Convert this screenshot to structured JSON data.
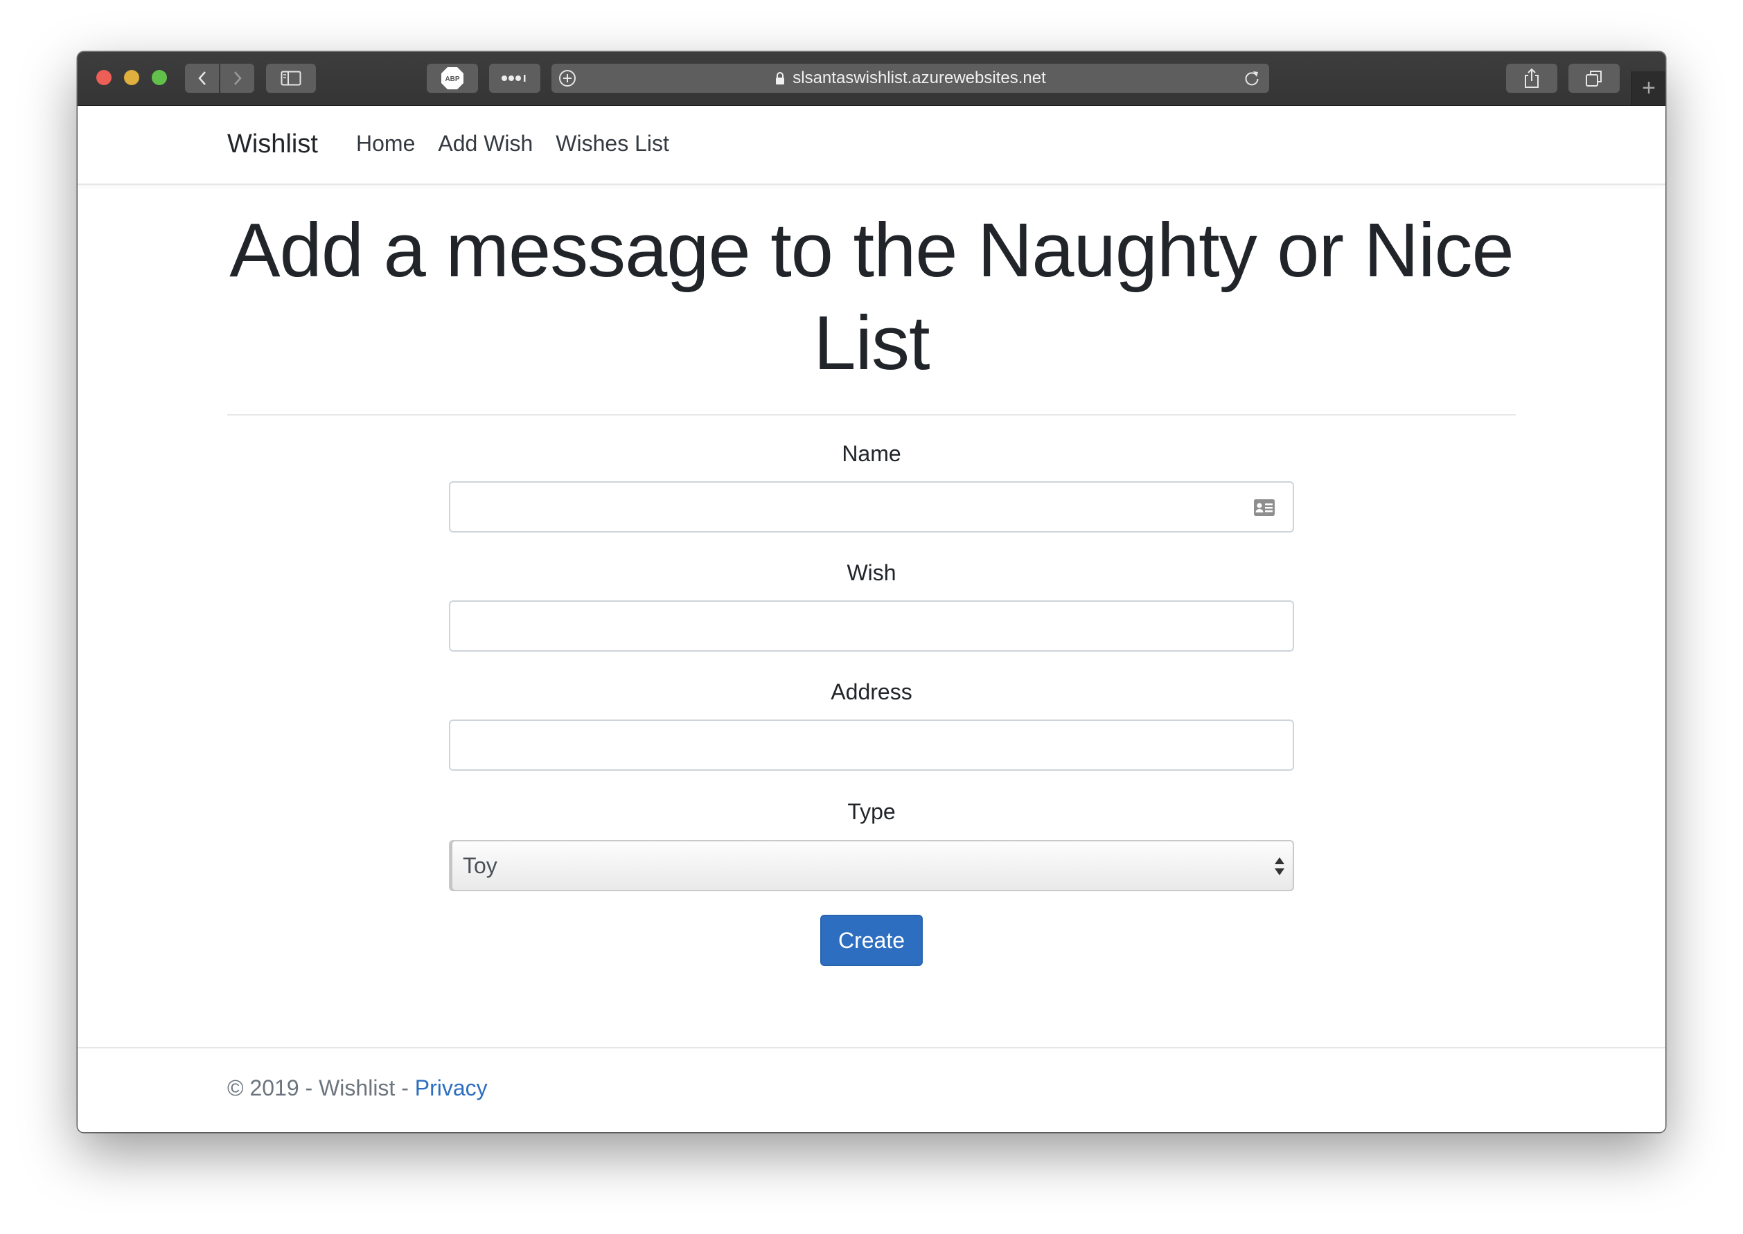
{
  "browser": {
    "url": "slsantaswishlist.azurewebsites.net",
    "abp_label": "ABP"
  },
  "navbar": {
    "brand": "Wishlist",
    "links": [
      "Home",
      "Add Wish",
      "Wishes List"
    ]
  },
  "page": {
    "title_line1": "Add a message to the Naughty or Nice",
    "title_line2": "List"
  },
  "form": {
    "name_label": "Name",
    "name_value": "",
    "wish_label": "Wish",
    "wish_value": "",
    "address_label": "Address",
    "address_value": "",
    "type_label": "Type",
    "type_selected": "Toy",
    "submit_label": "Create"
  },
  "footer": {
    "text": "© 2019 - Wishlist - ",
    "privacy_label": "Privacy"
  },
  "colors": {
    "primary": "#2d6ec0",
    "titlebar": "#3a3a3a"
  }
}
